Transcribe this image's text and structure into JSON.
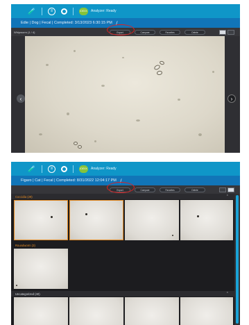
{
  "status": {
    "badge": "IDEXX",
    "label": "Analyzer: Ready"
  },
  "top_icons": [
    "sample-icon",
    "list-icon",
    "settings-icon"
  ],
  "toolbar": {
    "buttons": [
      "Export",
      "Compare",
      "Favorites",
      "Delete"
    ]
  },
  "screen1": {
    "info": "Edie | Dog | Fecal | Completed: 3/13/2023 6:30:15 PM",
    "image_label": "Whipworm (1 / 4)"
  },
  "screen2": {
    "info": "Figaro | Cat | Fecal | Completed: 8/31/2022 12:04:17 PM",
    "sections": [
      {
        "label": "Coccidia (29)"
      },
      {
        "label": "Roundworm (3)"
      },
      {
        "label": "Uncategorized (40)"
      }
    ]
  },
  "colors": {
    "topbar": "#0f96c8",
    "infobar": "#1175b8",
    "accent_orange": "#e58b23",
    "annotation": "#e02020",
    "ready": "#86c33a"
  }
}
